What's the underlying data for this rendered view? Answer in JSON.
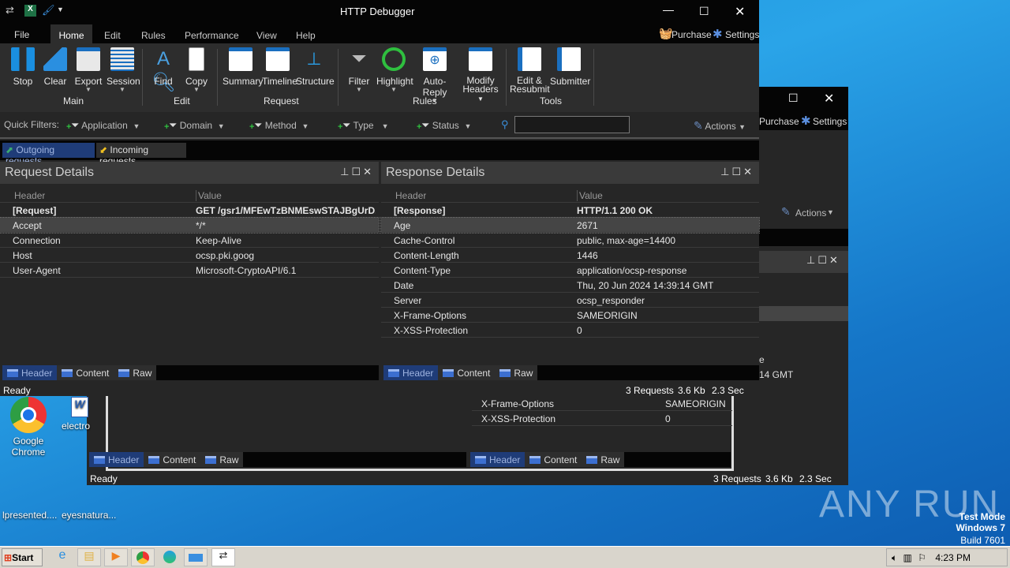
{
  "app": {
    "title": "HTTP Debugger"
  },
  "menu": {
    "items": [
      "File",
      "Home",
      "Edit",
      "Rules",
      "Performance",
      "View",
      "Help"
    ],
    "purchase": "Purchase",
    "settings": "Settings"
  },
  "ribbon": {
    "buttons": [
      {
        "label": "Stop"
      },
      {
        "label": "Clear"
      },
      {
        "label": "Export"
      },
      {
        "label": "Session"
      },
      {
        "label": "Find"
      },
      {
        "label": "Copy"
      },
      {
        "label": "Summary"
      },
      {
        "label": "Timeline"
      },
      {
        "label": "Structure"
      },
      {
        "label": "Filter"
      },
      {
        "label": "Highlight"
      },
      {
        "label": "Auto-Reply"
      },
      {
        "label": "Modify",
        "label2": "Headers"
      },
      {
        "label": "Edit &",
        "label2": "Resubmit"
      },
      {
        "label": "Submitter"
      }
    ],
    "groups": [
      "Main",
      "Edit",
      "Request",
      "Rules",
      "Tools"
    ]
  },
  "quickfilters": {
    "label": "Quick Filters:",
    "items": [
      "Application",
      "Domain",
      "Method",
      "Type",
      "Status"
    ],
    "search_value": "",
    "actions": "Actions"
  },
  "request_tabs": [
    "Outgoing requests",
    "Incoming requests"
  ],
  "request_panel": {
    "title": "Request Details",
    "columns": [
      "Header",
      "Value"
    ],
    "rows": [
      [
        "[Request]",
        "GET /gsr1/MFEwTzBNMEswSTAJBgUrD..."
      ],
      [
        "Accept",
        "*/*"
      ],
      [
        "Connection",
        "Keep-Alive"
      ],
      [
        "Host",
        "ocsp.pki.goog"
      ],
      [
        "User-Agent",
        "Microsoft-CryptoAPI/6.1"
      ]
    ]
  },
  "response_panel": {
    "title": "Response Details",
    "columns": [
      "Header",
      "Value"
    ],
    "rows": [
      [
        "[Response]",
        "HTTP/1.1 200 OK"
      ],
      [
        "Age",
        "2671"
      ],
      [
        "Cache-Control",
        "public, max-age=14400"
      ],
      [
        "Content-Length",
        "1446"
      ],
      [
        "Content-Type",
        "application/ocsp-response"
      ],
      [
        "Date",
        "Thu, 20 Jun 2024 14:39:14 GMT"
      ],
      [
        "Server",
        "ocsp_responder"
      ],
      [
        "X-Frame-Options",
        "SAMEORIGIN"
      ],
      [
        "X-XSS-Protection",
        "0"
      ]
    ]
  },
  "view_tabs": [
    "Header",
    "Content",
    "Raw"
  ],
  "status": {
    "ready": "Ready",
    "requests": "3 Requests",
    "size": "3.6 Kb",
    "time": "2.3 Sec"
  },
  "back_window": {
    "purchase": "Purchase",
    "settings": "Settings",
    "actions": "Actions",
    "row_frag1": "e",
    "row_frag2": "14 GMT",
    "rows": [
      [
        "X-Frame-Options",
        "SAMEORIGIN"
      ],
      [
        "X-XSS-Protection",
        "0"
      ]
    ]
  },
  "desktop": {
    "icons": [
      "Google Chrome",
      "electro",
      "lpresented....",
      "eyesnatura..."
    ],
    "watermark": "ANY RUN",
    "test_mode": [
      "Test Mode",
      "Windows 7",
      "Build 7601"
    ]
  },
  "taskbar": {
    "start": "Start",
    "clock": "4:23 PM"
  }
}
